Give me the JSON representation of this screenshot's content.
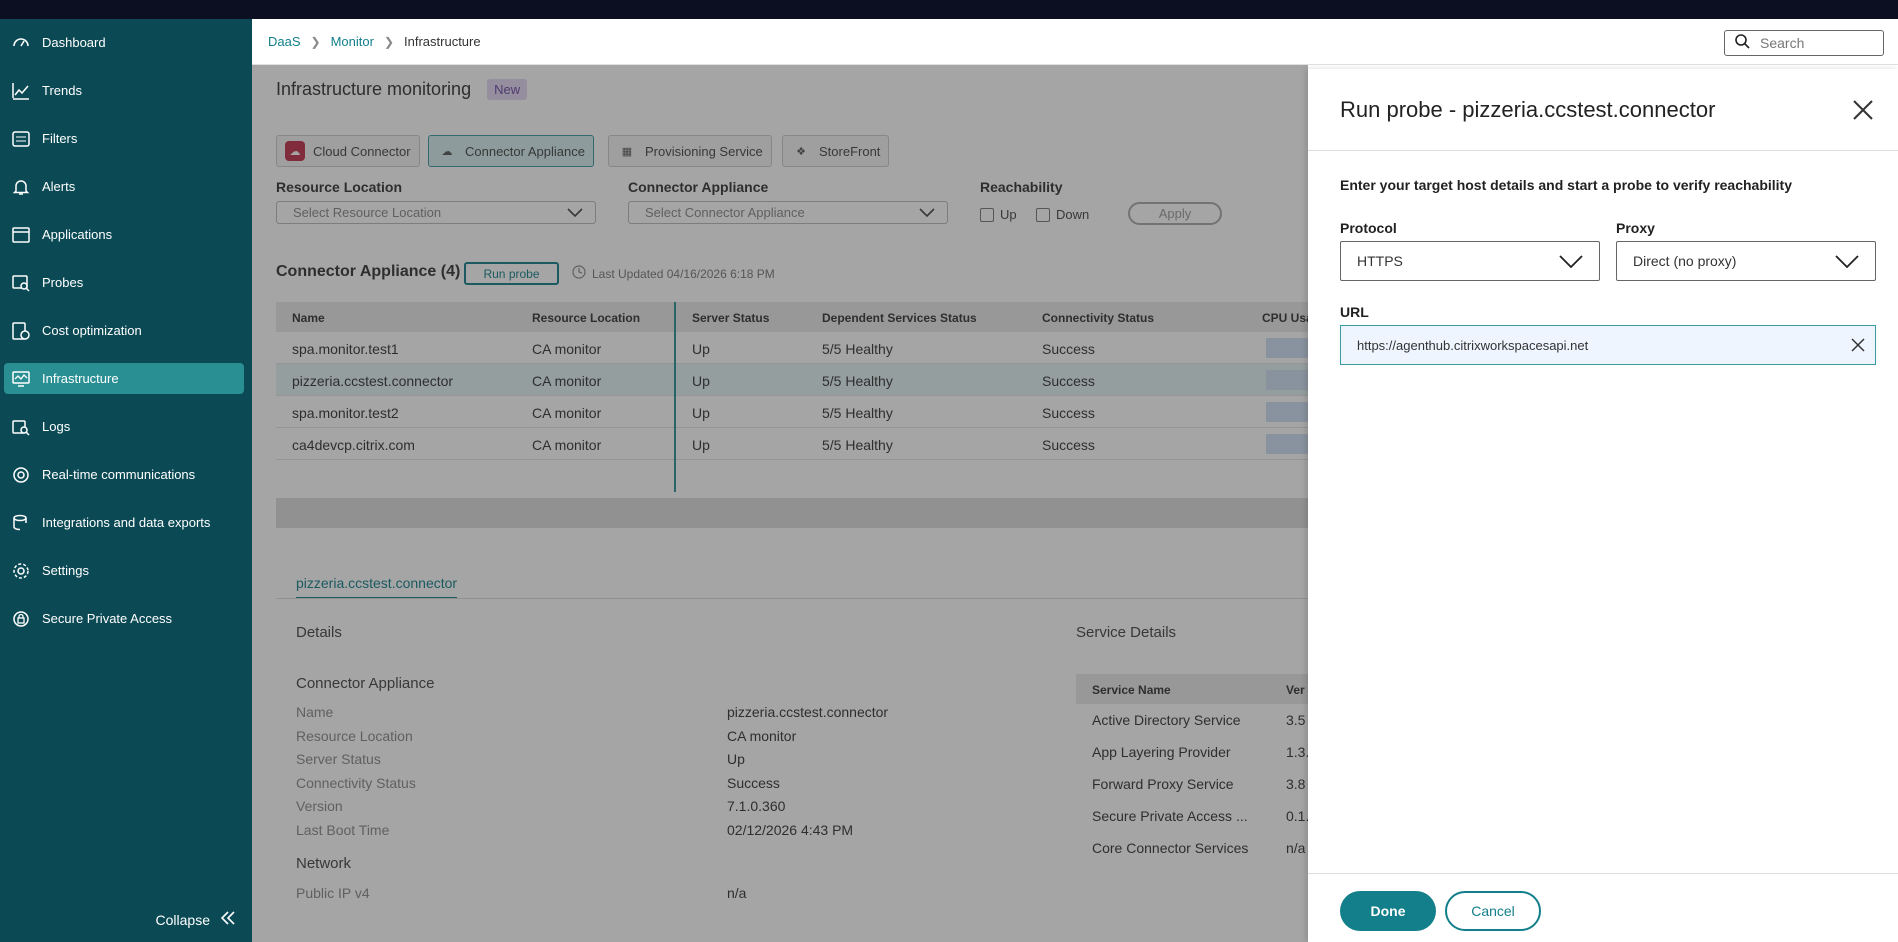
{
  "sidebar": {
    "items": [
      {
        "label": "Dashboard",
        "icon": "dashboard-icon"
      },
      {
        "label": "Trends",
        "icon": "trends-icon"
      },
      {
        "label": "Filters",
        "icon": "filters-icon"
      },
      {
        "label": "Alerts",
        "icon": "bell-icon"
      },
      {
        "label": "Applications",
        "icon": "applications-icon"
      },
      {
        "label": "Probes",
        "icon": "probes-icon"
      },
      {
        "label": "Cost optimization",
        "icon": "cost-icon"
      },
      {
        "label": "Infrastructure",
        "icon": "infrastructure-icon"
      },
      {
        "label": "Logs",
        "icon": "logs-icon"
      },
      {
        "label": "Real-time communications",
        "icon": "rtc-icon"
      },
      {
        "label": "Integrations and data exports",
        "icon": "integrations-icon"
      },
      {
        "label": "Settings",
        "icon": "gear-icon"
      },
      {
        "label": "Secure Private Access",
        "icon": "spa-icon"
      }
    ],
    "active": "Infrastructure",
    "collapse_label": "Collapse"
  },
  "header": {
    "breadcrumb": [
      "DaaS",
      "Monitor",
      "Infrastructure"
    ],
    "search_placeholder": "Search"
  },
  "main": {
    "title": "Infrastructure monitoring",
    "badge": "New",
    "chips": [
      "Cloud Connector",
      "Connector Appliance",
      "Provisioning Service",
      "StoreFront"
    ],
    "filters": {
      "resource_location_label": "Resource Location",
      "resource_location_placeholder": "Select Resource Location",
      "connector_appliance_label": "Connector Appliance",
      "connector_appliance_placeholder": "Select Connector Appliance",
      "reachability_label": "Reachability",
      "up_label": "Up",
      "down_label": "Down",
      "apply_label": "Apply"
    },
    "section_title": "Connector Appliance (4)",
    "run_probe_label": "Run probe",
    "last_updated": "Last Updated 04/16/2026 6:18 PM",
    "table": {
      "columns": [
        "Name",
        "Resource Location",
        "Server Status",
        "Dependent Services Status",
        "Connectivity Status",
        "CPU Usa"
      ],
      "rows": [
        [
          "spa.monitor.test1",
          "CA monitor",
          "Up",
          "5/5 Healthy",
          "Success"
        ],
        [
          "pizzeria.ccstest.connector",
          "CA monitor",
          "Up",
          "5/5 Healthy",
          "Success"
        ],
        [
          "spa.monitor.test2",
          "CA monitor",
          "Up",
          "5/5 Healthy",
          "Success"
        ],
        [
          "ca4devcp.citrix.com",
          "CA monitor",
          "Up",
          "5/5 Healthy",
          "Success"
        ]
      ]
    },
    "detail_tab": "pizzeria.ccstest.connector",
    "details_title": "Details",
    "service_details_title": "Service Details",
    "appliance_heading": "Connector Appliance",
    "details": [
      {
        "k": "Name",
        "v": "pizzeria.ccstest.connector"
      },
      {
        "k": "Resource Location",
        "v": "CA monitor"
      },
      {
        "k": "Server Status",
        "v": "Up"
      },
      {
        "k": "Connectivity Status",
        "v": "Success"
      },
      {
        "k": "Version",
        "v": "7.1.0.360"
      },
      {
        "k": "Last Boot Time",
        "v": "02/12/2026 4:43 PM"
      }
    ],
    "network_heading": "Network",
    "network": [
      {
        "k": "Public IP v4",
        "v": "n/a"
      }
    ],
    "service_columns": [
      "Service Name",
      "Ver"
    ],
    "services": [
      [
        "Active Directory Service",
        "3.5"
      ],
      [
        "App Layering Provider",
        "1.3."
      ],
      [
        "Forward Proxy Service",
        "3.8"
      ],
      [
        "Secure Private Access ...",
        "0.1."
      ],
      [
        "Core Connector Services",
        "n/a"
      ]
    ]
  },
  "panel": {
    "title": "Run probe - pizzeria.ccstest.connector",
    "intro": "Enter your target host details and start a probe to verify reachability",
    "protocol_label": "Protocol",
    "protocol_value": "HTTPS",
    "proxy_label": "Proxy",
    "proxy_value": "Direct (no proxy)",
    "url_label": "URL",
    "url_value": "https://agenthub.citrixworkspacesapi.net",
    "done_label": "Done",
    "cancel_label": "Cancel"
  },
  "colors": {
    "sidebar": "#0b4a55",
    "accent": "#127f8a",
    "active": "#2a8f93"
  }
}
